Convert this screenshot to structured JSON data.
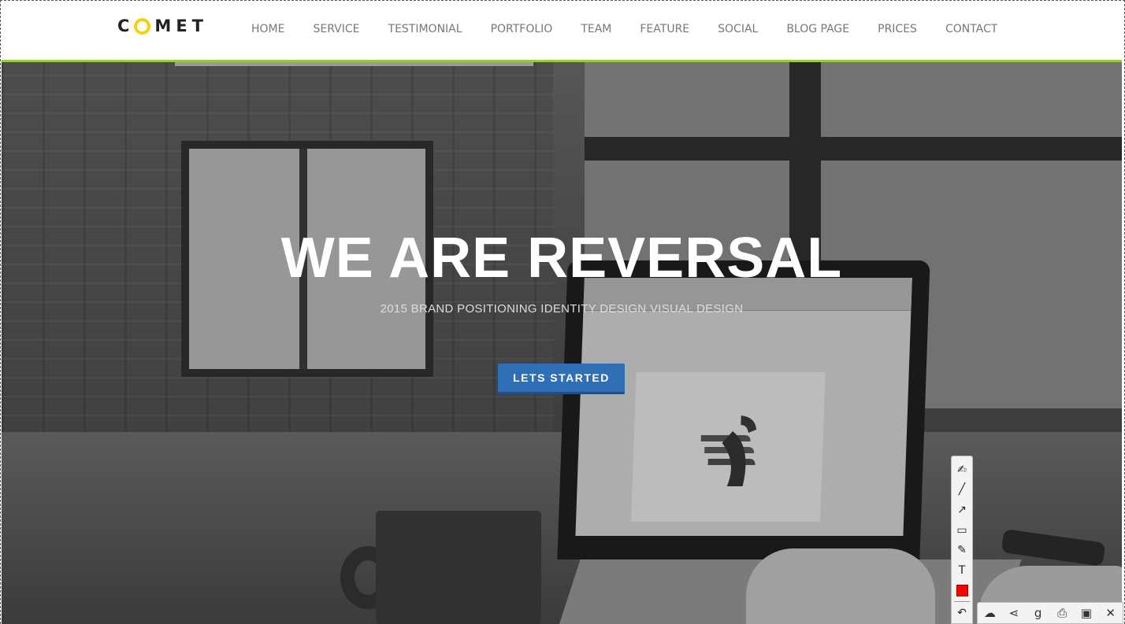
{
  "logo": {
    "text_before": "C",
    "text_after": "MET",
    "ring_color": "#f5d20c"
  },
  "nav": {
    "items": [
      "HOME",
      "SERVICE",
      "TESTIMONIAL",
      "PORTFOLIO",
      "TEAM",
      "FEATURE",
      "SOCIAL",
      "BLOG PAGE",
      "PRICES",
      "CONTACT"
    ]
  },
  "header": {
    "accent_color": "#9bcb3b"
  },
  "hero": {
    "title": "WE ARE REVERSAL",
    "subtitle": "2015 BRAND POSITIONING IDENTITY DESIGN VISUAL DESIGN",
    "cta_label": "LETS STARTED",
    "cta_color": "#2f6fb5"
  },
  "annotation_toolbar": {
    "tools": [
      {
        "name": "pen-icon",
        "glyph": "✍"
      },
      {
        "name": "line-icon",
        "glyph": "╱"
      },
      {
        "name": "arrow-icon",
        "glyph": "↗"
      },
      {
        "name": "rectangle-icon",
        "glyph": "▭"
      },
      {
        "name": "highlighter-icon",
        "glyph": "✎"
      },
      {
        "name": "text-icon",
        "glyph": "T"
      }
    ],
    "current_color": "#ff0000",
    "undo_glyph": "↶"
  },
  "action_bar": {
    "buttons": [
      {
        "name": "cloud-upload-icon",
        "glyph": "☁"
      },
      {
        "name": "share-icon",
        "glyph": "⋖"
      },
      {
        "name": "google-icon",
        "glyph": "g"
      },
      {
        "name": "print-icon",
        "glyph": "⎙"
      },
      {
        "name": "save-icon",
        "glyph": "▣"
      },
      {
        "name": "close-icon",
        "glyph": "✕"
      }
    ]
  }
}
